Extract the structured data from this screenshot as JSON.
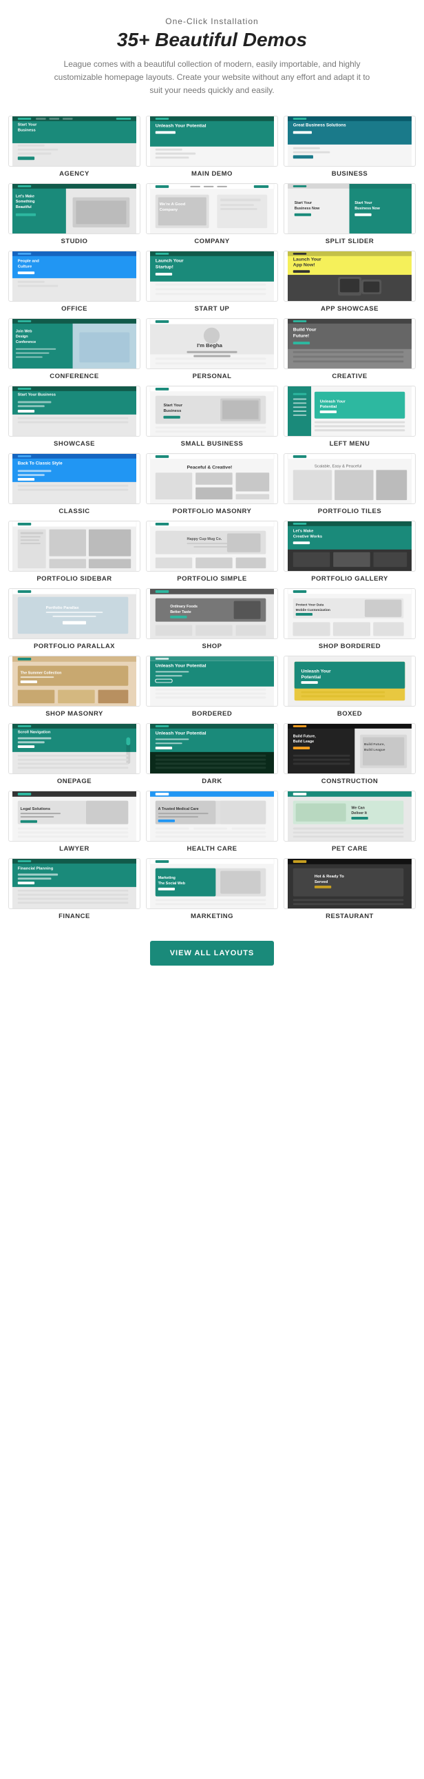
{
  "header": {
    "subtitle": "One-Click Installation",
    "title": "35+ Beautiful Demos",
    "description": "League comes with a beautiful collection of modern, easily importable, and highly customizable homepage layouts. Create your website without any effort and adapt it to suit your needs quickly and easily."
  },
  "demos": [
    {
      "id": "agency",
      "label": "AGENCY",
      "bg": "#1a8a7a",
      "accent": "#2db8a0",
      "text": "Start Your Business",
      "style": "agency"
    },
    {
      "id": "main-demo",
      "label": "MAIN DEMO",
      "bg": "#1a8a7a",
      "accent": "#2db8a0",
      "text": "Unleash Your Potential",
      "style": "main-demo"
    },
    {
      "id": "business",
      "label": "BUSINESS",
      "bg": "#1a7a8a",
      "accent": "#2196a0",
      "text": "Great Business Solutions",
      "style": "business"
    },
    {
      "id": "studio",
      "label": "STUDIO",
      "bg": "#1a8a7a",
      "accent": "#2db8a0",
      "text": "Let's Make Something Beautiful",
      "style": "studio"
    },
    {
      "id": "company",
      "label": "COMPANY",
      "bg": "#e8e8e8",
      "accent": "#1a8a7a",
      "text": "We're A Good Company",
      "style": "company"
    },
    {
      "id": "split",
      "label": "SPLIT SLIDER",
      "bg": "#f5f5f5",
      "accent": "#1a8a7a",
      "text": "Start Your Business Now",
      "style": "split"
    },
    {
      "id": "office",
      "label": "OFFICE",
      "bg": "#2196F3",
      "accent": "#1565C0",
      "text": "People and Culture",
      "style": "office"
    },
    {
      "id": "startup",
      "label": "START UP",
      "bg": "#1a8a7a",
      "accent": "#3ab89a",
      "text": "Launch Your Startup!",
      "style": "startup"
    },
    {
      "id": "app",
      "label": "APP SHOWCASE",
      "bg": "#f5f05a",
      "accent": "#444",
      "text": "Launch Your App Now!",
      "style": "app"
    },
    {
      "id": "conference",
      "label": "CONFERENCE",
      "bg": "#1a8a7a",
      "accent": "#2db8a0",
      "text": "Join Web Design Conference",
      "style": "conference"
    },
    {
      "id": "personal",
      "label": "PERSONAL",
      "bg": "#e8e8e8",
      "accent": "#1a8a7a",
      "text": "I'm Begha",
      "style": "personal"
    },
    {
      "id": "creative",
      "label": "CREATIVE",
      "bg": "#888",
      "accent": "#aaa",
      "text": "Build Your Future!",
      "style": "creative"
    },
    {
      "id": "showcase",
      "label": "SHOWCASE",
      "bg": "#1a8a7a",
      "accent": "#2db8a0",
      "text": "Start Your Business",
      "style": "showcase"
    },
    {
      "id": "small-business",
      "label": "SMALL BUSINESS",
      "bg": "#e8e8e8",
      "accent": "#ddd",
      "text": "Start Your Business",
      "style": "small-biz"
    },
    {
      "id": "left-menu",
      "label": "LEFT MENU",
      "bg": "#1a8a7a",
      "accent": "#f5f5f5",
      "text": "Unleash Your Potential",
      "style": "left-menu"
    },
    {
      "id": "classic",
      "label": "CLASSIC",
      "bg": "#2196F3",
      "accent": "#1565C0",
      "text": "Back To Classic Style",
      "style": "classic"
    },
    {
      "id": "portfolio-masonry",
      "label": "PORTFOLIO MASONRY",
      "bg": "#e8e8e8",
      "accent": "#1a8a7a",
      "text": "Peaceful & Creative!",
      "style": "portfolio-masonry"
    },
    {
      "id": "portfolio-tiles",
      "label": "PORTFOLIO TILES",
      "bg": "#ccc",
      "accent": "#ddd",
      "text": "Scalable, Easy & Peaceful",
      "style": "portfolio-tiles"
    },
    {
      "id": "portfolio-sidebar",
      "label": "PORTFOLIO SIDEBAR",
      "bg": "#e8e8e8",
      "accent": "#ddd",
      "text": "",
      "style": "portfolio-sidebar"
    },
    {
      "id": "portfolio-simple",
      "label": "PORTFOLIO SIMPLE",
      "bg": "#f5f5f5",
      "accent": "#1a8a7a",
      "text": "Happy Cup Mug Co.",
      "style": "portfolio-simple"
    },
    {
      "id": "portfolio-gallery",
      "label": "PORTFOLIO GALLERY",
      "bg": "#1a8a7a",
      "accent": "#333",
      "text": "Let's Make Creative Works",
      "style": "portfolio-gallery"
    },
    {
      "id": "portfolio-parallax",
      "label": "PORTFOLIO PARALLAX",
      "bg": "#d4e8f0",
      "accent": "#e8e8e8",
      "text": "",
      "style": "portfolio-parallax"
    },
    {
      "id": "shop",
      "label": "SHOP",
      "bg": "#888",
      "accent": "#e8e8e8",
      "text": "Ordinary Foods Better Taste",
      "style": "shop"
    },
    {
      "id": "shop-bordered",
      "label": "SHOP BORDERED",
      "bg": "#e8e8e8",
      "accent": "#888",
      "text": "Protect Your Data Mobile Customization",
      "style": "shop-bordered"
    },
    {
      "id": "shop-masonry",
      "label": "SHOP MASONRY",
      "bg": "#e8d4b8",
      "accent": "#b89a6a",
      "text": "The Summer Collection",
      "style": "shop-masonry"
    },
    {
      "id": "bordered",
      "label": "BORDERED",
      "bg": "#1a8a7a",
      "accent": "#2db8a0",
      "text": "Unleash Your Potential",
      "style": "bordered"
    },
    {
      "id": "boxed",
      "label": "BOXED",
      "bg": "#e8c840",
      "accent": "#1a8a7a",
      "text": "Unleash Your Potential",
      "style": "boxed"
    },
    {
      "id": "onepage",
      "label": "ONEPAGE",
      "bg": "#1a8a7a",
      "accent": "#2db8a0",
      "text": "Scroll Navigation",
      "style": "onepage"
    },
    {
      "id": "dark",
      "label": "DARK",
      "bg": "#1a8a7a",
      "accent": "#0a3a2a",
      "text": "Unleash Your Potential",
      "style": "dark"
    },
    {
      "id": "construction",
      "label": "CONSTRUCTION",
      "bg": "#222",
      "accent": "#e8e8e8",
      "text": "Build Future, Build League",
      "style": "construction"
    },
    {
      "id": "lawyer",
      "label": "LAWYER",
      "bg": "#e8e8e8",
      "accent": "#1a8a7a",
      "text": "Legal Solutions",
      "style": "lawyer"
    },
    {
      "id": "health-care",
      "label": "HEALTH CARE",
      "bg": "#e8e8e8",
      "accent": "#2196F3",
      "text": "A Trusted Medical Care",
      "style": "health"
    },
    {
      "id": "pet-care",
      "label": "PET CARE",
      "bg": "#1a8a7a",
      "accent": "#2db8a0",
      "text": "We Can Deliver It",
      "style": "pet-care"
    },
    {
      "id": "finance",
      "label": "FINANCE",
      "bg": "#1a8a7a",
      "accent": "#2db8a0",
      "text": "Financial Planning",
      "style": "finance"
    },
    {
      "id": "marketing",
      "label": "MARKETING",
      "bg": "#e8e8e8",
      "accent": "#1a8a7a",
      "text": "Marketing The Social Web",
      "style": "marketing"
    },
    {
      "id": "restaurant",
      "label": "RESTAURANT",
      "bg": "#222",
      "accent": "#e8e8e8",
      "text": "Hot & Ready To Served",
      "style": "restaurant"
    }
  ],
  "view_all_label": "VIEW ALL LAYOUTS",
  "colors": {
    "primary": "#1a8a7a",
    "button_bg": "#1a8a7a",
    "button_text": "#ffffff"
  }
}
